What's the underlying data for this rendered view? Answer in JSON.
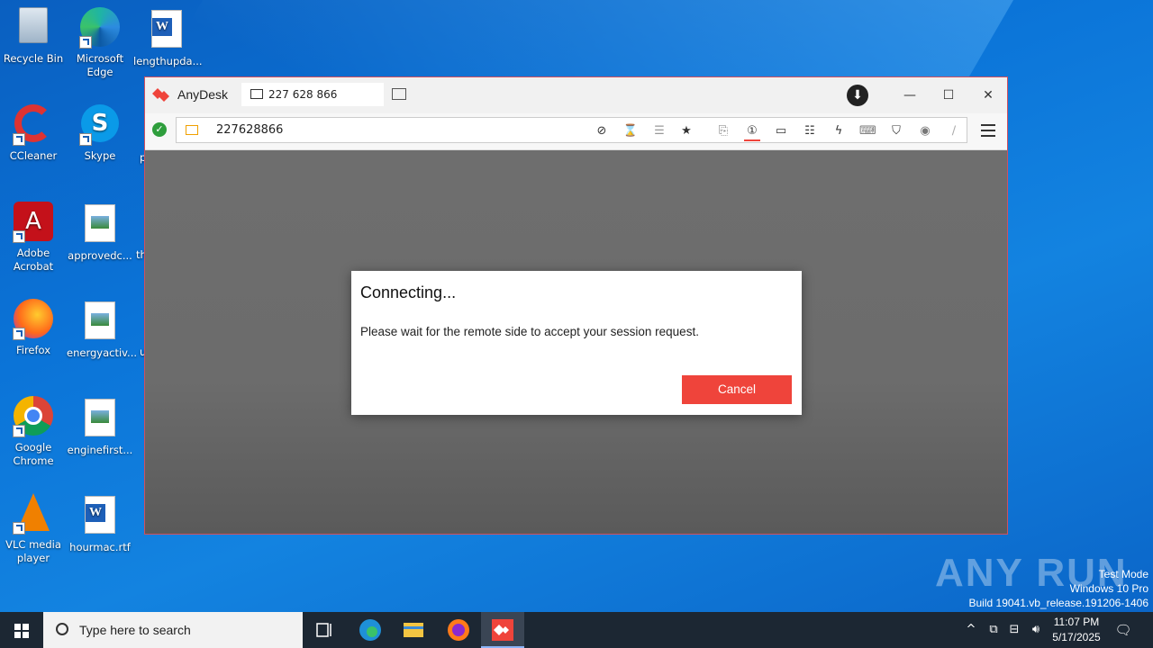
{
  "desktop": {
    "icons": [
      {
        "label": "Recycle Bin"
      },
      {
        "label": "Microsoft Edge"
      },
      {
        "label": "lengthupda..."
      },
      {
        "label": "CCleaner"
      },
      {
        "label": "Skype"
      },
      {
        "label": "Adobe Acrobat"
      },
      {
        "label": "approvedc..."
      },
      {
        "label": "Firefox"
      },
      {
        "label": "energyactiv..."
      },
      {
        "label": "Google Chrome"
      },
      {
        "label": "enginefirst..."
      },
      {
        "label": "VLC media player"
      },
      {
        "label": "hourmac.rtf"
      }
    ],
    "partial_labels": [
      "p",
      "th",
      "u"
    ]
  },
  "anydesk": {
    "app_name": "AnyDesk",
    "tab_id": "227 628 866",
    "address_value": "227628866",
    "dialog": {
      "title": "Connecting...",
      "message": "Please wait for the remote side to accept your session request.",
      "cancel_label": "Cancel"
    },
    "colors": {
      "accent": "#ef443b",
      "connected": "#2e9e3c"
    }
  },
  "watermark": {
    "brand": "ANY RUN",
    "lines": [
      "Test Mode",
      "Windows 10 Pro",
      "Build 19041.vb_release.191206-1406"
    ]
  },
  "taskbar": {
    "search_placeholder": "Type here to search",
    "time": "11:07 PM",
    "date": "5/17/2025"
  }
}
